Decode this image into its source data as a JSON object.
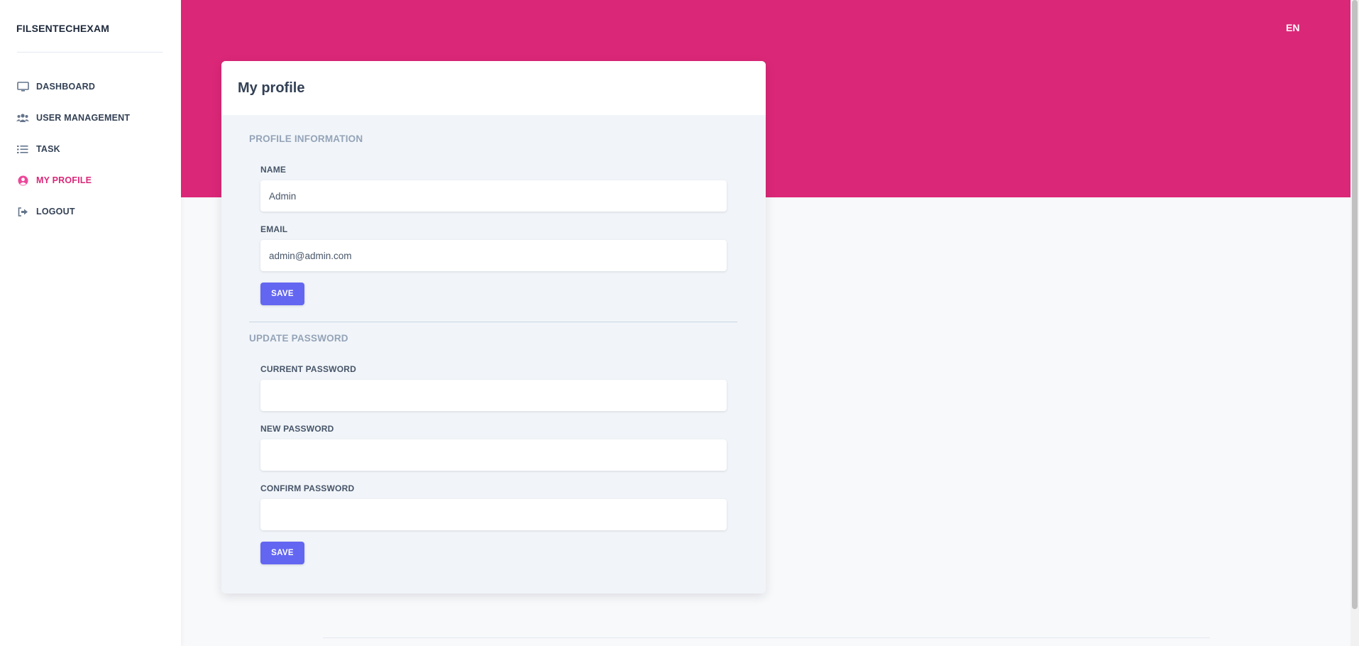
{
  "app": {
    "brand": "FILSENTECHEXAM",
    "language": "EN"
  },
  "sidebar": {
    "items": [
      {
        "label": "DASHBOARD",
        "icon": "monitor-icon",
        "active": false
      },
      {
        "label": "USER MANAGEMENT",
        "icon": "users-icon",
        "active": false
      },
      {
        "label": "TASK",
        "icon": "list-icon",
        "active": false
      },
      {
        "label": "MY PROFILE",
        "icon": "user-circle-icon",
        "active": true
      },
      {
        "label": "LOGOUT",
        "icon": "logout-icon",
        "active": false
      }
    ]
  },
  "page": {
    "title": "My profile"
  },
  "profile": {
    "section_title": "PROFILE INFORMATION",
    "name_label": "NAME",
    "name_value": "Admin",
    "email_label": "EMAIL",
    "email_value": "admin@admin.com",
    "save_label": "SAVE"
  },
  "password": {
    "section_title": "UPDATE PASSWORD",
    "current_label": "CURRENT PASSWORD",
    "current_value": "",
    "new_label": "NEW PASSWORD",
    "new_value": "",
    "confirm_label": "CONFIRM PASSWORD",
    "confirm_value": "",
    "save_label": "SAVE"
  },
  "colors": {
    "header": "#db2777",
    "active_nav": "#db2777",
    "button": "#6366f1"
  }
}
